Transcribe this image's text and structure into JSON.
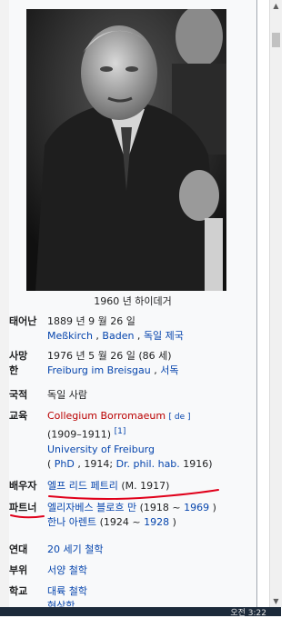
{
  "caption": "1960 년 하이데거",
  "rows": {
    "born": {
      "label": "태어난",
      "line1": "1889 년 9 월 26 일",
      "line2_link1": "Meßkirch",
      "line2_sep1": " , ",
      "line2_link2": "Baden",
      "line2_sep2": " , ",
      "line2_link3": "독일 제국"
    },
    "died": {
      "label1": "사망",
      "label2": "한",
      "line1": "1976 년 5 월 26 일 (86 세)",
      "line2_link1": "Freiburg im Breisgau",
      "line2_sep": " , ",
      "line2_link2": "서독"
    },
    "nationality": {
      "label": "국적",
      "value": "독일 사람"
    },
    "education": {
      "label": "교육",
      "school1": "Collegium Borromaeum",
      "lang": "[ de ]",
      "years": "(1909–1911)",
      "ref": "[1]",
      "school2": "University of Freiburg",
      "deg_open": "( ",
      "deg_phd": "PhD",
      "deg_mid": " , 1914; ",
      "deg_hab": "Dr. phil. hab.",
      "deg_close": " 1916)"
    },
    "spouse": {
      "label": "배우자",
      "name": "엘프 리드 페트리",
      "married": " (M. 1917)"
    },
    "partner": {
      "label": "파트너",
      "p1_name": "엘리자베스 블로흐 만",
      "p1_years_a": " (1918 ~ ",
      "p1_years_link": "1969",
      "p1_years_b": " )",
      "p2_name": "한나 아렌트",
      "p2_years_a": " (1924 ~ ",
      "p2_years_link": "1928",
      "p2_years_b": " )"
    },
    "era": {
      "label": "연대",
      "value": "20 세기 철학"
    },
    "region": {
      "label": "부위",
      "value": "서양 철학"
    },
    "school": {
      "label": "학교",
      "value1": "대륙 철학",
      "value2": "현상학"
    }
  },
  "taskbar": {
    "clock": "오전 3:22"
  },
  "colors": {
    "link": "#0645ad",
    "redlink": "#ba0000",
    "annotation": "#e0001a"
  }
}
